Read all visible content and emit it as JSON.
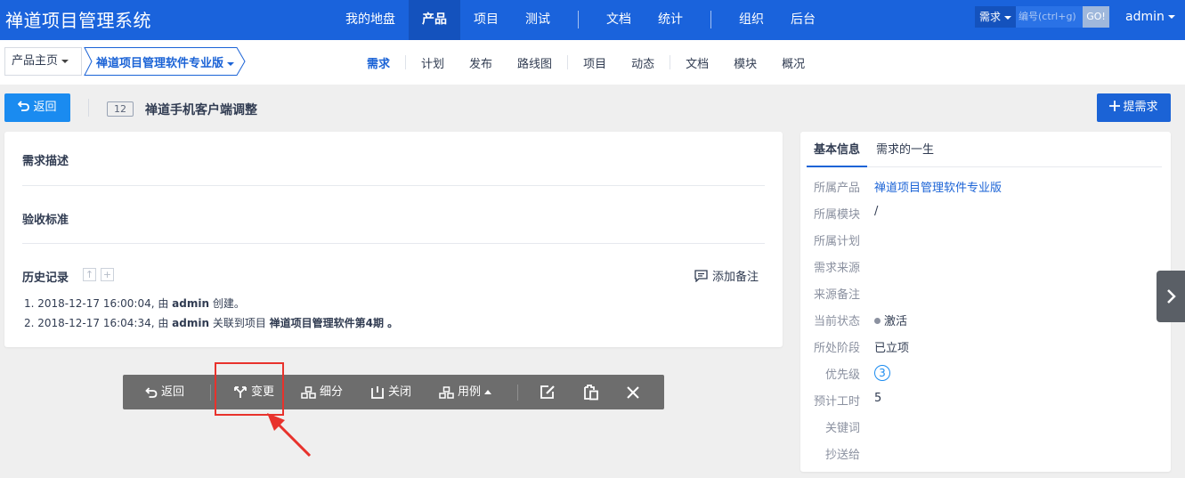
{
  "brand": "禅道项目管理系统",
  "main_nav": [
    "我的地盘",
    "产品",
    "项目",
    "测试",
    "文档",
    "统计",
    "组织",
    "后台"
  ],
  "main_nav_active": "产品",
  "search": {
    "type": "需求",
    "placeholder": "编号(ctrl+g)",
    "go": "GO!"
  },
  "user": "admin",
  "breadcrumb": {
    "home": "产品主页",
    "product": "禅道项目管理软件专业版"
  },
  "sub_nav": [
    "需求",
    "计划",
    "发布",
    "路线图",
    "项目",
    "动态",
    "文档",
    "模块",
    "概况"
  ],
  "sub_nav_active": "需求",
  "title_row": {
    "back": "返回",
    "story_id": "12",
    "story_title": "禅道手机客户端调整",
    "new_story": "提需求"
  },
  "main": {
    "desc_title": "需求描述",
    "verify_title": "验收标准",
    "history_title": "历史记录",
    "history_up": "↑",
    "history_add": "+",
    "add_note": "添加备注",
    "history": [
      {
        "prefix": "1. 2018-12-17 16:00:04, 由 ",
        "user": "admin",
        "middle": " 创建。",
        "bold": ""
      },
      {
        "prefix": "2. 2018-12-17 16:04:34, 由 ",
        "user": "admin",
        "middle": " 关联到项目 ",
        "bold": "禅道项目管理软件第4期 。"
      }
    ]
  },
  "actions": {
    "back": "返回",
    "change": "变更",
    "subdivide": "细分",
    "close": "关闭",
    "case": "用例"
  },
  "side": {
    "tabs": [
      "基本信息",
      "需求的一生"
    ],
    "props": [
      {
        "label": "所属产品",
        "value": "禅道项目管理软件专业版",
        "link": true
      },
      {
        "label": "所属模块",
        "value": "/"
      },
      {
        "label": "所属计划",
        "value": ""
      },
      {
        "label": "需求来源",
        "value": ""
      },
      {
        "label": "来源备注",
        "value": ""
      },
      {
        "label": "当前状态",
        "value": "激活"
      },
      {
        "label": "所处阶段",
        "value": "已立项"
      },
      {
        "label": "优先级",
        "value": "3"
      },
      {
        "label": "预计工时",
        "value": "5"
      },
      {
        "label": "关键词",
        "value": ""
      },
      {
        "label": "抄送给",
        "value": ""
      }
    ]
  },
  "colors": {
    "primary": "#1b63d6",
    "navbar": "#1a63dc",
    "highlight": "#e8322c"
  }
}
